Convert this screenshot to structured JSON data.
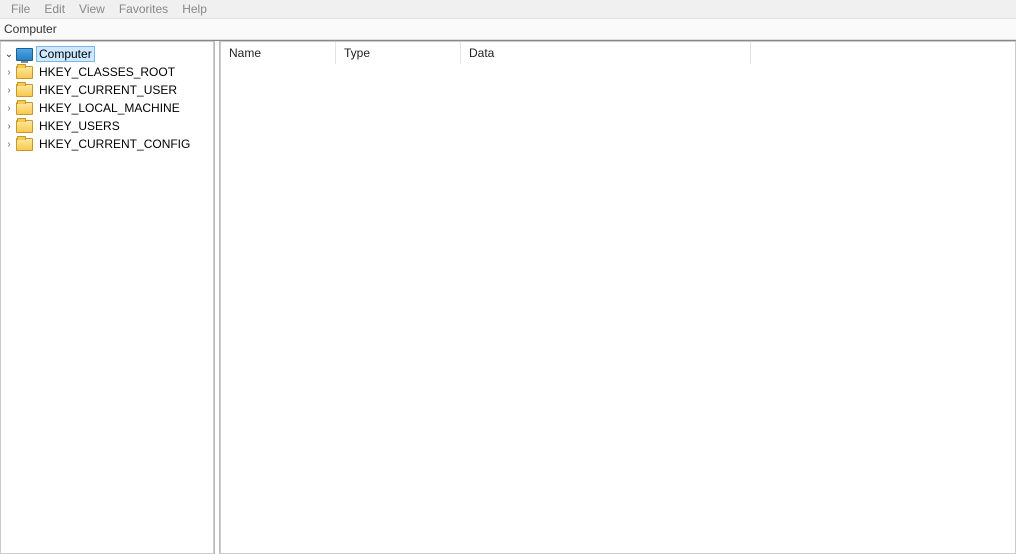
{
  "menu": {
    "items": [
      "File",
      "Edit",
      "View",
      "Favorites",
      "Help"
    ]
  },
  "address": {
    "path": "Computer"
  },
  "tree": {
    "root": {
      "label": "Computer",
      "expanded": true,
      "selected": true,
      "icon": "computer",
      "children": [
        {
          "label": "HKEY_CLASSES_ROOT",
          "icon": "folder",
          "expanded": false
        },
        {
          "label": "HKEY_CURRENT_USER",
          "icon": "folder",
          "expanded": false
        },
        {
          "label": "HKEY_LOCAL_MACHINE",
          "icon": "folder",
          "expanded": false
        },
        {
          "label": "HKEY_USERS",
          "icon": "folder",
          "expanded": false
        },
        {
          "label": "HKEY_CURRENT_CONFIG",
          "icon": "folder",
          "expanded": false
        }
      ]
    }
  },
  "list": {
    "columns": {
      "name": "Name",
      "type": "Type",
      "data": "Data"
    },
    "rows": []
  },
  "glyphs": {
    "expander_open": "⌄",
    "expander_closed": "›"
  }
}
